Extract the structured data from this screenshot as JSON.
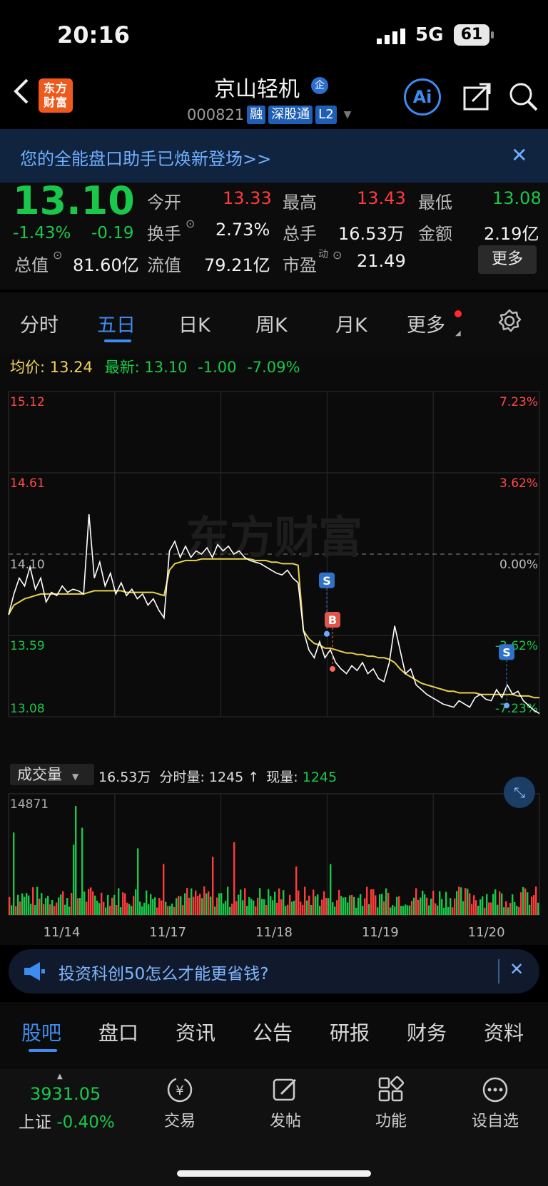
{
  "status_bar": {
    "time": "20:16",
    "network": "5G",
    "battery": "61"
  },
  "header": {
    "logo_text": "东方财富",
    "stock_name": "京山轻机",
    "badge": "企",
    "code": "000821",
    "tags": [
      "融",
      "深股通",
      "L2"
    ],
    "ai_label": "Ai"
  },
  "banner": {
    "text": "您的全能盘口助手已焕新登场>>"
  },
  "quote": {
    "price": "13.10",
    "change_pct": "-1.43%",
    "change": "-0.19",
    "open_label": "今开",
    "open": "13.33",
    "high_label": "最高",
    "high": "13.43",
    "low_label": "最低",
    "low": "13.08",
    "turnover_label": "换手",
    "turnover": "2.73%",
    "volume_label": "总手",
    "volume": "16.53万",
    "amount_label": "金额",
    "amount": "2.19亿",
    "mktcap_label": "总值",
    "mktcap": "81.60亿",
    "float_label": "流值",
    "float": "79.21亿",
    "pe_label": "市盈",
    "pe_sup": "动",
    "pe": "21.49",
    "more_button": "更多"
  },
  "period_tabs": [
    "分时",
    "五日",
    "日K",
    "周K",
    "月K",
    "更多"
  ],
  "active_tab": 1,
  "chart_info": {
    "avg_label": "均价:",
    "avg": "13.24",
    "latest_label": "最新:",
    "latest": "13.10",
    "latest_change": "-1.00",
    "latest_pct": "-7.09%"
  },
  "chart_data": {
    "type": "line",
    "price_ticks": [
      "15.12",
      "14.61",
      "14.10",
      "13.59",
      "13.08"
    ],
    "pct_ticks": [
      "7.23%",
      "3.62%",
      "0.00%",
      "-3.62%",
      "-7.23%"
    ],
    "ylim": [
      13.08,
      15.12
    ],
    "dates": [
      "11/14",
      "11/17",
      "11/18",
      "11/19",
      "11/20"
    ],
    "watermark": "东方财富",
    "series": [
      {
        "values": [
          13.72,
          13.85,
          13.95,
          13.9,
          14.02,
          13.88,
          13.95,
          13.8,
          13.86,
          13.84,
          13.9,
          13.86,
          13.88,
          13.87,
          13.85,
          14.35,
          13.95,
          14.05,
          13.9,
          13.98,
          13.85,
          13.92,
          13.84,
          13.88,
          13.82,
          13.85,
          13.78,
          13.82,
          13.75,
          13.7,
          14.12,
          14.18,
          14.08,
          14.15,
          14.08,
          14.12,
          14.1,
          14.14,
          14.08,
          14.16,
          14.12,
          14.15,
          14.1,
          14.12,
          14.08,
          14.06,
          14.05,
          14.04,
          14.02,
          14.0,
          13.98,
          13.97,
          14.0,
          13.95,
          13.92,
          13.62,
          13.5,
          13.45,
          13.55,
          13.45,
          13.5,
          13.42,
          13.38,
          13.35,
          13.4,
          13.37,
          13.42,
          13.35,
          13.38,
          13.32,
          13.3,
          13.42,
          13.65,
          13.5,
          13.35,
          13.38,
          13.28,
          13.25,
          13.22,
          13.2,
          13.18,
          13.16,
          13.15,
          13.14,
          13.18,
          13.16,
          13.14,
          13.2,
          13.22,
          13.19,
          13.18,
          13.25,
          13.2,
          13.28,
          13.22,
          13.24,
          13.18,
          13.15,
          13.12,
          13.1
        ]
      },
      {
        "values": [
          13.72,
          13.78,
          13.8,
          13.82,
          13.83,
          13.84,
          13.85,
          13.85,
          13.85,
          13.85,
          13.85,
          13.85,
          13.85,
          13.85,
          13.85,
          13.86,
          13.87,
          13.87,
          13.87,
          13.87,
          13.87,
          13.87,
          13.86,
          13.86,
          13.86,
          13.86,
          13.86,
          13.86,
          13.85,
          13.84,
          14.0,
          14.04,
          14.05,
          14.06,
          14.06,
          14.06,
          14.07,
          14.07,
          14.07,
          14.07,
          14.07,
          14.07,
          14.07,
          14.07,
          14.07,
          14.07,
          14.06,
          14.06,
          14.06,
          14.05,
          14.05,
          14.04,
          14.04,
          14.04,
          14.03,
          13.62,
          13.57,
          13.54,
          13.53,
          13.51,
          13.51,
          13.5,
          13.49,
          13.48,
          13.48,
          13.47,
          13.47,
          13.46,
          13.46,
          13.45,
          13.45,
          13.44,
          13.42,
          13.38,
          13.35,
          13.33,
          13.31,
          13.29,
          13.28,
          13.27,
          13.26,
          13.25,
          13.24,
          13.24,
          13.23,
          13.23,
          13.23,
          13.23,
          13.22,
          13.22,
          13.22,
          13.22,
          13.22,
          13.22,
          13.22,
          13.21,
          13.21,
          13.21,
          13.2,
          13.2
        ]
      }
    ]
  },
  "markers": [
    {
      "label": "S",
      "type": "sell"
    },
    {
      "label": "B",
      "type": "buy"
    },
    {
      "label": "S",
      "type": "sell"
    }
  ],
  "volume_panel": {
    "selector": "成交量",
    "total": "16.53万",
    "minute_label": "分时量:",
    "minute": "1245",
    "now_label": "现量:",
    "now": "1245",
    "max_tick": "14871",
    "chart_data": {
      "type": "bar",
      "ylim": [
        0,
        14871
      ]
    }
  },
  "ad": {
    "text": "投资科创50怎么才能更省钱?"
  },
  "sub_tabs": [
    "股吧",
    "盘口",
    "资讯",
    "公告",
    "研报",
    "财务",
    "资料"
  ],
  "active_sub_tab": 0,
  "bottom_bar": {
    "index_value": "3931.05",
    "index_name": "上证",
    "index_pct": "-0.40%",
    "items": [
      "交易",
      "发帖",
      "功能",
      "设自选"
    ]
  },
  "colors": {
    "up": "#ff3b3b",
    "down": "#19c84a",
    "avg": "#f2d35a",
    "accent": "#3d8cf0"
  }
}
